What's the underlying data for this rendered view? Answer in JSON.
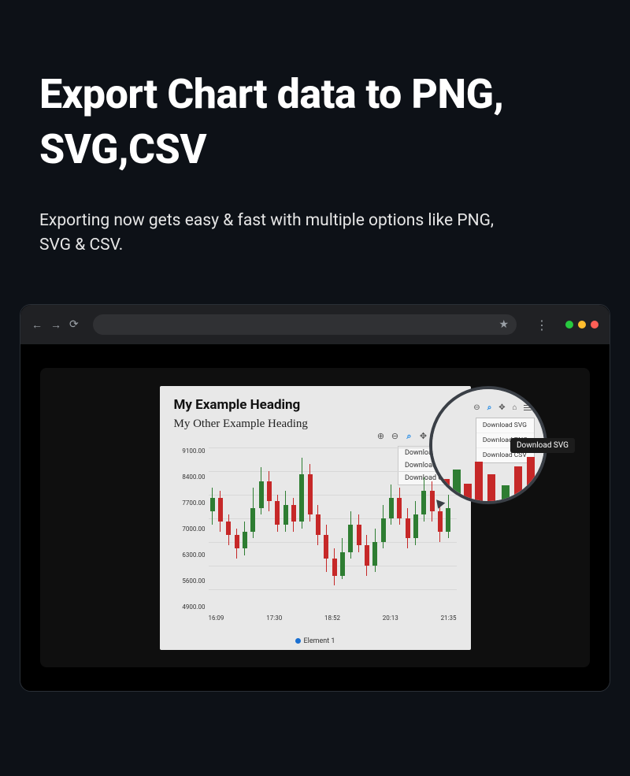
{
  "heading": "Export Chart data to PNG, SVG,CSV",
  "subheading": "Exporting now gets easy & fast with multiple options like PNG, SVG & CSV.",
  "chart": {
    "title": "My Example Heading",
    "subtitle": "My Other Example Heading",
    "legend": "Element 1",
    "y_ticks": [
      "9100.00",
      "8400.00",
      "7700.00",
      "7000.00",
      "6300.00",
      "5600.00",
      "4900.00"
    ],
    "x_ticks": [
      "16:09",
      "17:30",
      "18:52",
      "20:13",
      "21:35"
    ],
    "toolbar_icons": [
      "plus",
      "minus",
      "search",
      "zoom",
      "home",
      "menu"
    ],
    "dropdown_items": [
      "Download SVG",
      "Download PNG",
      "Download CSV"
    ]
  },
  "magnifier": {
    "toolbar_icons": [
      "plus",
      "search",
      "zoom",
      "home",
      "menu"
    ],
    "dropdown_items": [
      "Download SVG",
      "Download PNG",
      "Download CSV"
    ],
    "tooltip": "Download SVG"
  },
  "chart_data": {
    "type": "candlestick",
    "title": "My Example Heading",
    "subtitle": "My Other Example Heading",
    "xlabel": "",
    "ylabel": "",
    "ylim": [
      4900,
      9100
    ],
    "x_ticks": [
      "16:09",
      "17:30",
      "18:52",
      "20:13",
      "21:35"
    ],
    "series": [
      {
        "name": "Element 1",
        "candles": [
          {
            "i": 0,
            "open": 7200,
            "close": 7600,
            "low": 6800,
            "high": 7900,
            "dir": "green"
          },
          {
            "i": 1,
            "open": 7600,
            "close": 6900,
            "low": 6600,
            "high": 7800,
            "dir": "red"
          },
          {
            "i": 2,
            "open": 6900,
            "close": 6500,
            "low": 6200,
            "high": 7100,
            "dir": "red"
          },
          {
            "i": 3,
            "open": 6500,
            "close": 6100,
            "low": 5800,
            "high": 6700,
            "dir": "red"
          },
          {
            "i": 4,
            "open": 6100,
            "close": 6600,
            "low": 5900,
            "high": 6900,
            "dir": "green"
          },
          {
            "i": 5,
            "open": 6600,
            "close": 7300,
            "low": 6400,
            "high": 7900,
            "dir": "green"
          },
          {
            "i": 6,
            "open": 7300,
            "close": 8100,
            "low": 7100,
            "high": 8500,
            "dir": "green"
          },
          {
            "i": 7,
            "open": 8100,
            "close": 7500,
            "low": 7200,
            "high": 8400,
            "dir": "red"
          },
          {
            "i": 8,
            "open": 7500,
            "close": 6800,
            "low": 6600,
            "high": 7700,
            "dir": "red"
          },
          {
            "i": 9,
            "open": 6800,
            "close": 7400,
            "low": 6600,
            "high": 7800,
            "dir": "green"
          },
          {
            "i": 10,
            "open": 7400,
            "close": 6900,
            "low": 6600,
            "high": 7600,
            "dir": "red"
          },
          {
            "i": 11,
            "open": 6900,
            "close": 8300,
            "low": 6700,
            "high": 8800,
            "dir": "green"
          },
          {
            "i": 12,
            "open": 8300,
            "close": 7100,
            "low": 6900,
            "high": 8600,
            "dir": "red"
          },
          {
            "i": 13,
            "open": 7100,
            "close": 6500,
            "low": 6200,
            "high": 7400,
            "dir": "red"
          },
          {
            "i": 14,
            "open": 6500,
            "close": 5800,
            "low": 5400,
            "high": 6800,
            "dir": "red"
          },
          {
            "i": 15,
            "open": 5800,
            "close": 5300,
            "low": 5000,
            "high": 6100,
            "dir": "red"
          },
          {
            "i": 16,
            "open": 5300,
            "close": 6000,
            "low": 5200,
            "high": 6400,
            "dir": "green"
          },
          {
            "i": 17,
            "open": 6000,
            "close": 6800,
            "low": 5800,
            "high": 7200,
            "dir": "green"
          },
          {
            "i": 18,
            "open": 6800,
            "close": 6200,
            "low": 6000,
            "high": 7100,
            "dir": "red"
          },
          {
            "i": 19,
            "open": 6200,
            "close": 5600,
            "low": 5300,
            "high": 6500,
            "dir": "red"
          },
          {
            "i": 20,
            "open": 5600,
            "close": 6300,
            "low": 5400,
            "high": 6700,
            "dir": "green"
          },
          {
            "i": 21,
            "open": 6300,
            "close": 7000,
            "low": 6100,
            "high": 7400,
            "dir": "green"
          },
          {
            "i": 22,
            "open": 7000,
            "close": 7600,
            "low": 6800,
            "high": 8000,
            "dir": "green"
          },
          {
            "i": 23,
            "open": 7600,
            "close": 7000,
            "low": 6800,
            "high": 7900,
            "dir": "red"
          },
          {
            "i": 24,
            "open": 7000,
            "close": 6400,
            "low": 6100,
            "high": 7300,
            "dir": "red"
          },
          {
            "i": 25,
            "open": 6400,
            "close": 7100,
            "low": 6200,
            "high": 7500,
            "dir": "green"
          },
          {
            "i": 26,
            "open": 7100,
            "close": 7800,
            "low": 6900,
            "high": 8200,
            "dir": "green"
          },
          {
            "i": 27,
            "open": 7800,
            "close": 7200,
            "low": 6900,
            "high": 8100,
            "dir": "red"
          },
          {
            "i": 28,
            "open": 7200,
            "close": 6600,
            "low": 6300,
            "high": 7500,
            "dir": "red"
          },
          {
            "i": 29,
            "open": 6600,
            "close": 7300,
            "low": 6400,
            "high": 7700,
            "dir": "green"
          }
        ]
      }
    ]
  }
}
